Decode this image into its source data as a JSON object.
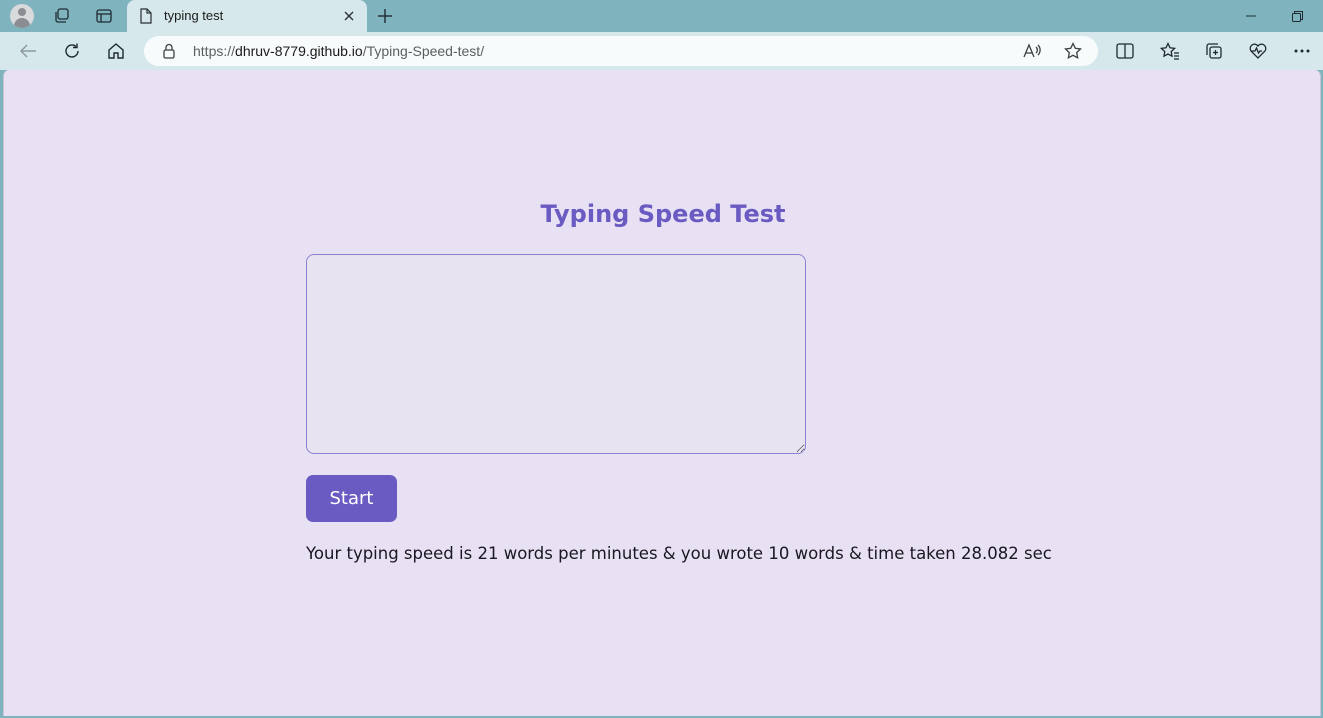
{
  "browser": {
    "tab": {
      "title": "typing test"
    },
    "address_bar": {
      "url_prefix": "https://",
      "url_host": "dhruv-8779.github.io",
      "url_path": "/Typing-Speed-test/"
    }
  },
  "page": {
    "heading": "Typing Speed Test",
    "textarea": {
      "value": "",
      "placeholder": ""
    },
    "start_button_label": "Start",
    "result_text": "Your typing speed is 21 words per minutes & you wrote 10 words & time taken 28.082 sec"
  },
  "theme": {
    "background": "#e8e0f3",
    "accent": "#6a5bc2",
    "browser_frame": "#7fb4bf"
  }
}
